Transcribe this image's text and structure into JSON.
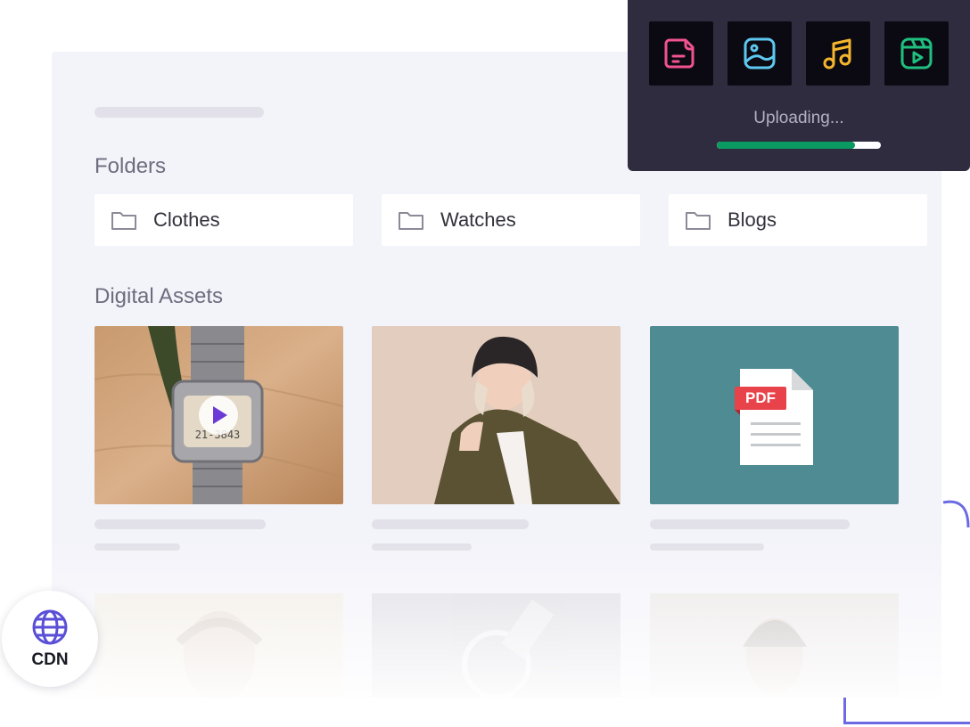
{
  "folders_section": {
    "title": "Folders",
    "folders": [
      {
        "label": "Clothes"
      },
      {
        "label": "Watches"
      },
      {
        "label": "Blogs"
      }
    ]
  },
  "assets_section": {
    "title": "Digital Assets",
    "assets": [
      {
        "type": "video",
        "icon": "play-icon"
      },
      {
        "type": "image"
      },
      {
        "type": "pdf",
        "badge": "PDF"
      }
    ]
  },
  "upload": {
    "status": "Uploading...",
    "progress": 0.84,
    "tiles": [
      {
        "icon": "document-icon",
        "color": "#f0538f"
      },
      {
        "icon": "image-icon",
        "color": "#5ec8f0"
      },
      {
        "icon": "music-icon",
        "color": "#f5b62d"
      },
      {
        "icon": "video-icon",
        "color": "#1fbf7f"
      }
    ],
    "progress_color": "#0a9a62"
  },
  "cdn_badge": {
    "label": "CDN",
    "icon": "globe-icon",
    "color": "#5a4fd6"
  },
  "colors": {
    "accent": "#6b6ae2",
    "panel": "#f3f3fa",
    "pdf_tile": "#4e8b93"
  }
}
